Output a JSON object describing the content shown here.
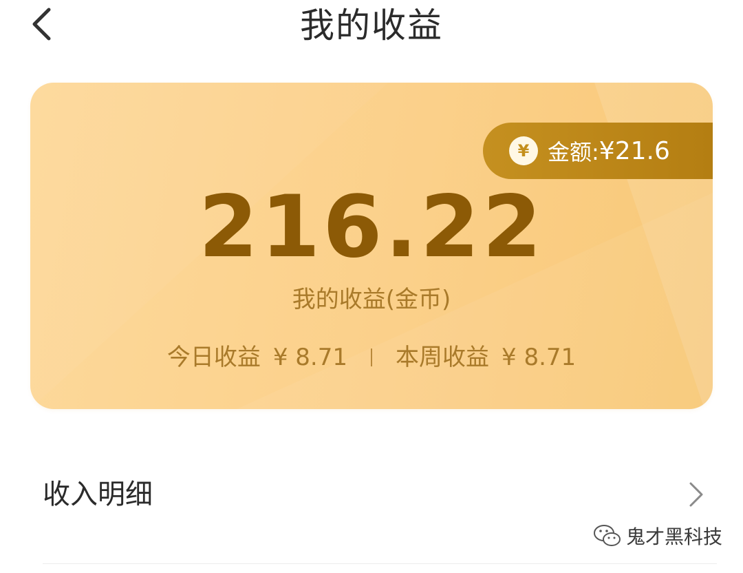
{
  "header": {
    "title": "我的收益",
    "back_icon": "chevron-left-icon"
  },
  "earnings_card": {
    "amount_label": "金额:",
    "amount_value": "¥21.6",
    "coin_symbol": "¥",
    "total_coins": "216.22",
    "total_caption": "我的收益(金币)",
    "today_label": "今日收益",
    "today_value": "¥ 8.71",
    "week_label": "本周收益",
    "week_value": "¥ 8.71"
  },
  "details": {
    "label": "收入明细",
    "chevron_icon": "chevron-right-icon"
  },
  "watermark": {
    "text": "鬼才黑科技",
    "icon": "wechat-icon"
  },
  "colors": {
    "card_bg": "#fbd08a",
    "pill_bg": "#b98316",
    "big_number": "#8c5a06",
    "card_text": "#a97a2a"
  }
}
